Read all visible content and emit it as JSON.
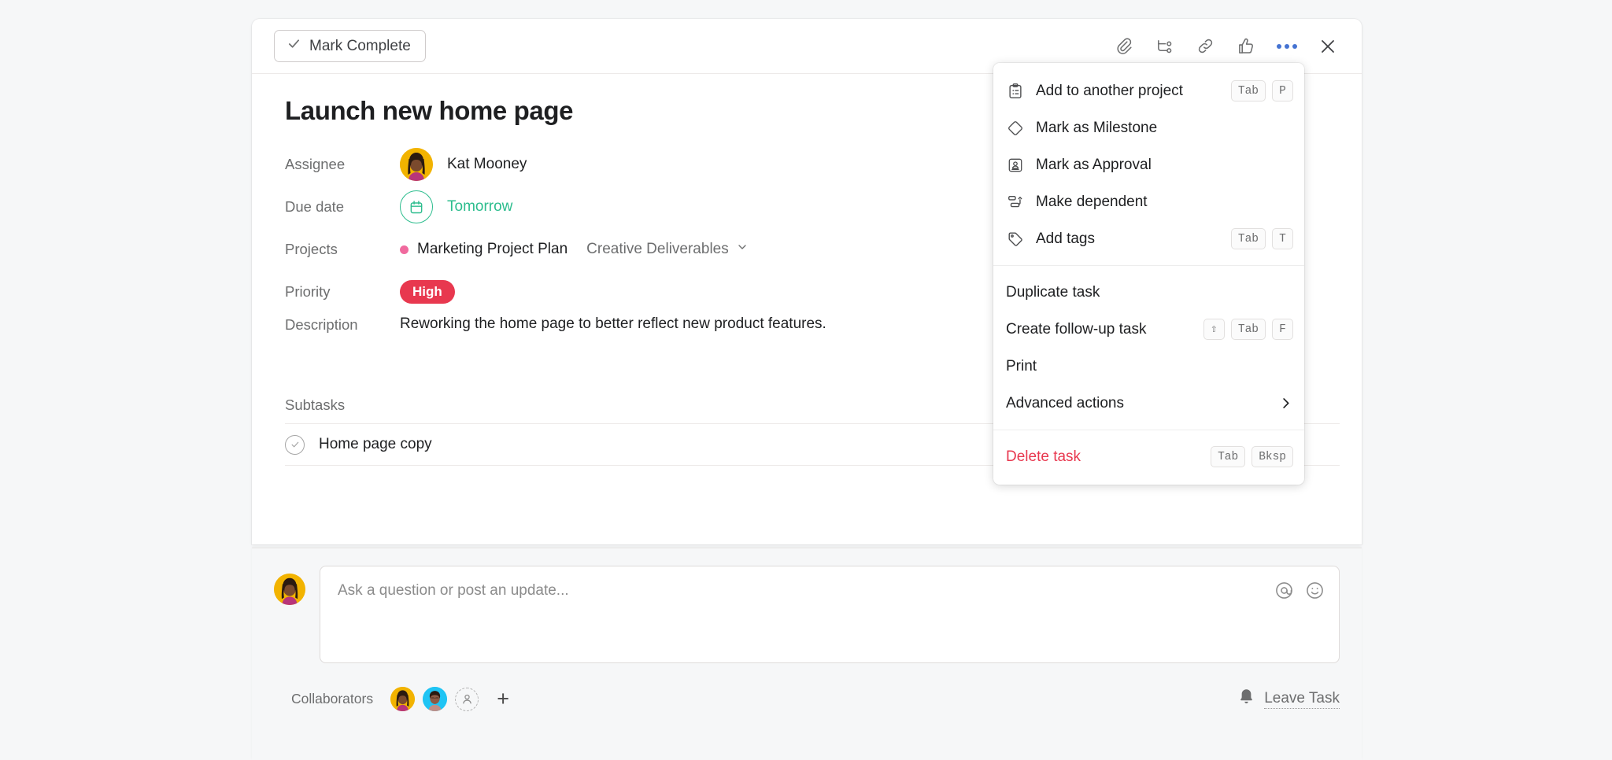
{
  "header": {
    "mark_complete_label": "Mark Complete",
    "actions": [
      {
        "name": "attachment-icon",
        "title": "Attach file"
      },
      {
        "name": "subtask-icon",
        "title": "Add subtask"
      },
      {
        "name": "link-icon",
        "title": "Copy task link"
      },
      {
        "name": "like-icon",
        "title": "Like task"
      },
      {
        "name": "more-options-icon",
        "title": "More options"
      },
      {
        "name": "close-icon",
        "title": "Close details"
      }
    ]
  },
  "task": {
    "title": "Launch new home page",
    "fields": {
      "assignee_label": "Assignee",
      "assignee_name": "Kat Mooney",
      "due_date_label": "Due date",
      "due_date_value": "Tomorrow",
      "projects_label": "Projects",
      "project_name": "Marketing Project Plan",
      "project_section": "Creative Deliverables",
      "priority_label": "Priority",
      "priority_value": "High",
      "description_label": "Description",
      "description_value": "Reworking the home page to better reflect new product features."
    },
    "subtasks_label": "Subtasks",
    "subtasks": [
      {
        "title": "Home page copy"
      }
    ]
  },
  "composer": {
    "placeholder": "Ask a question or post an update...",
    "mention_icon": "mention-icon",
    "emoji_icon": "emoji-icon",
    "collaborators_label": "Collaborators",
    "add_collaborator_label": "+",
    "leave_task_label": "Leave Task"
  },
  "menu": {
    "groups": [
      {
        "items": [
          {
            "label": "Add to another project",
            "icon": "clipboard-list-icon",
            "keys": [
              "Tab",
              "P"
            ]
          },
          {
            "label": "Mark as Milestone",
            "icon": "diamond-icon",
            "keys": []
          },
          {
            "label": "Mark as Approval",
            "icon": "stamp-icon",
            "keys": []
          },
          {
            "label": "Make dependent",
            "icon": "dependency-icon",
            "keys": []
          },
          {
            "label": "Add tags",
            "icon": "tag-icon",
            "keys": [
              "Tab",
              "T"
            ]
          }
        ]
      },
      {
        "items": [
          {
            "label": "Duplicate task",
            "icon": null,
            "keys": []
          },
          {
            "label": "Create follow-up task",
            "icon": null,
            "keys": [
              "⇧",
              "Tab",
              "F"
            ]
          },
          {
            "label": "Print",
            "icon": null,
            "keys": []
          },
          {
            "label": "Advanced actions",
            "icon": null,
            "keys": [],
            "submenu": true
          }
        ]
      },
      {
        "items": [
          {
            "label": "Delete task",
            "icon": null,
            "keys": [
              "Tab",
              "Bksp"
            ],
            "danger": true
          }
        ]
      }
    ]
  },
  "colors": {
    "accent_blue": "#4573d2",
    "due_green": "#2dbd8e",
    "priority_red": "#e8384f",
    "project_dot_pink": "#f06a9e",
    "page_bg": "#f6f7f8"
  }
}
